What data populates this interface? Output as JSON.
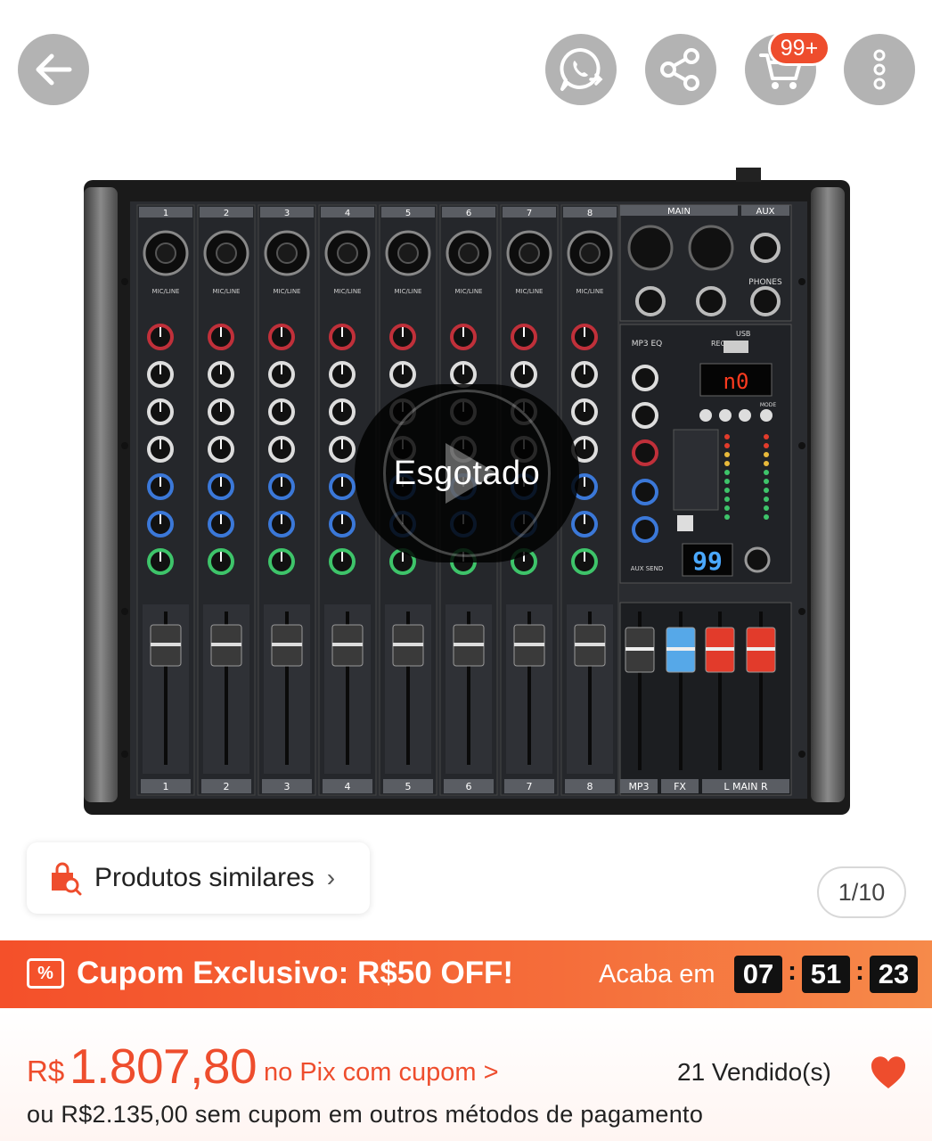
{
  "header": {
    "cart_badge": "99+",
    "icons": [
      "back-arrow-icon",
      "whatsapp-icon",
      "share-icon",
      "cart-icon",
      "more-vertical-icon"
    ]
  },
  "gallery": {
    "sold_out_label": "Esgotado",
    "counter": "1/10",
    "mixer_channel_numbers": [
      "1",
      "2",
      "3",
      "4",
      "5",
      "6",
      "7",
      "8"
    ],
    "mixer_labels": {
      "mic_line": "MIC/LINE",
      "main": "MAIN",
      "aux": "AUX",
      "phones": "PHONES",
      "usb": "USB",
      "rec": "REC•",
      "mp3_eq": "MP3 EQ",
      "display_top": "n0",
      "display_bottom": "99",
      "mode": "MODE",
      "aux_send": "AUX SEND",
      "bottom_mp3": "MP3",
      "bottom_fx": "FX",
      "bottom_main": "L MAIN R"
    }
  },
  "similar": {
    "label": "Produtos similares",
    "chevron": "›"
  },
  "coupon": {
    "icon_text": "%",
    "title": "Cupom Exclusivo: R$50 OFF!",
    "ends_label": "Acaba em",
    "timer": [
      "07",
      "51",
      "23"
    ],
    "separator": ":",
    "colors": {
      "banner": "#f4502a",
      "timer_bg": "#111111"
    }
  },
  "price": {
    "currency": "R$",
    "value": "1.807,80",
    "pix_link": "no Pix com cupom >",
    "sold": "21 Vendido(s)",
    "alt_price": "ou R$2.135,00 sem cupom em outros métodos de pagamento",
    "colors": {
      "accent": "#ee4d2d"
    }
  }
}
